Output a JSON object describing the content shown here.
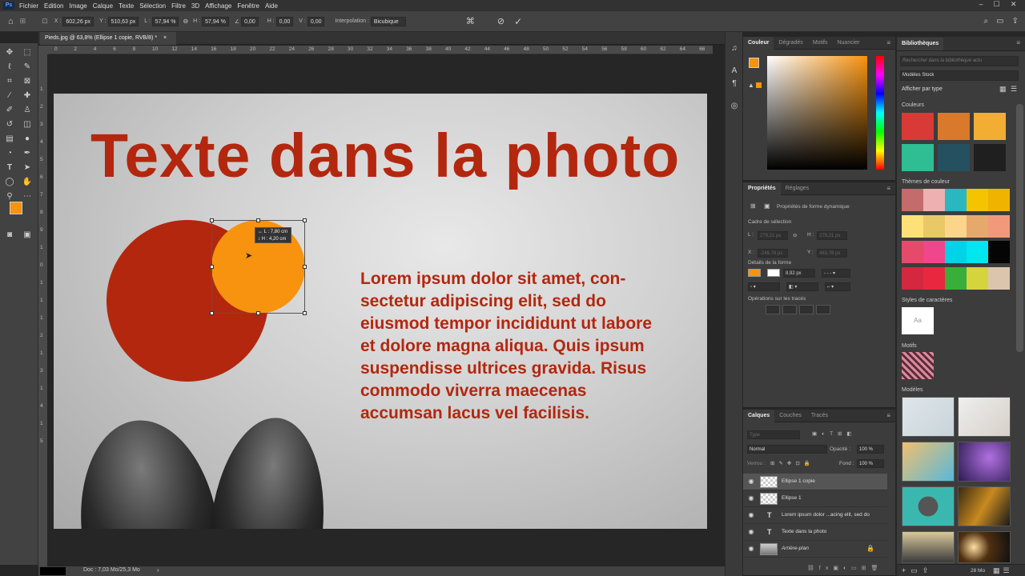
{
  "menu": {
    "logo": "Ps",
    "items": [
      "Fichier",
      "Edition",
      "Image",
      "Calque",
      "Texte",
      "Sélection",
      "Filtre",
      "3D",
      "Affichage",
      "Fenêtre",
      "Aide"
    ]
  },
  "options": {
    "x_label": "X :",
    "x": "602,26 px",
    "y_label": "Y :",
    "y": "510,63 px",
    "l_label": "L :",
    "l": "57,94 %",
    "h_label": "H :",
    "h": "57,94 %",
    "angle": "0,00",
    "h2_label": "H :",
    "h2": "0,00",
    "v_label": "V :",
    "v": "0,00",
    "interp_label": "Interpolation :",
    "interp": "Bicubique"
  },
  "document": {
    "tab": "Pieds.jpg @ 63,8% (Ellipse 1 copie, RVB/8) *",
    "close": "×"
  },
  "ruler": {
    "top": [
      "0",
      "2",
      "4",
      "6",
      "8",
      "10",
      "12",
      "14",
      "16",
      "18",
      "20",
      "22",
      "24",
      "26",
      "28",
      "30",
      "32",
      "34",
      "36",
      "38",
      "40",
      "42",
      "44",
      "46",
      "48",
      "50",
      "52",
      "54",
      "56",
      "58",
      "60",
      "62",
      "64",
      "66"
    ],
    "left": [
      "1",
      "2",
      "3",
      "4",
      "5",
      "6",
      "7",
      "8",
      "9",
      "1",
      "0",
      "1",
      "1",
      "1",
      "2",
      "1",
      "3",
      "1",
      "4",
      "1",
      "5"
    ]
  },
  "photo": {
    "headline": "Texte dans la photo",
    "body": "Lorem ipsum dolor sit amet, con-sectetur adipiscing elit, sed do eiusmod tempor incididunt ut labore et dolore magna aliqua. Quis ipsum suspendisse ultrices gravida. Risus commodo viverra maecenas accumsan lacus vel facilisis.",
    "tooltip_l": "↔ L : 7,80 cm",
    "tooltip_h": "↕ H : 4,20 cm",
    "colors": {
      "red": "#b3270f",
      "orange": "#f7930e"
    }
  },
  "status": {
    "doc": "Doc : 7,03 Mo/25,3 Mo"
  },
  "color_panel": {
    "tabs": [
      "Couleur",
      "Dégradés",
      "Motifs",
      "Nuancier"
    ]
  },
  "props_panel": {
    "tabs": [
      "Propriétés",
      "Réglages"
    ],
    "subtitle": "Propriétés de forme dynamique",
    "sec_bounds": "Cadre de sélection",
    "l": "L :",
    "l_val": "279,21 px",
    "h": "H :",
    "h_val": "279,21 px",
    "x": "X :",
    "x_val": "-246,78 px",
    "y": "Y :",
    "y_val": "463,78 px",
    "sec_shape": "Détails de la forme",
    "stroke": "8,92 px",
    "sec_ops": "Opérations sur les tracés"
  },
  "layers_panel": {
    "tabs": [
      "Calques",
      "Couches",
      "Tracés"
    ],
    "search": "Type",
    "blend": "Normal",
    "opacity_label": "Opacité :",
    "opacity": "100 %",
    "lock_label": "Verrou :",
    "fill_label": "Fond :",
    "fill": "100 %",
    "layers": [
      {
        "name": "Ellipse 1 copie",
        "kind": "shape",
        "selected": true
      },
      {
        "name": "Ellipse 1",
        "kind": "shape",
        "selected": false
      },
      {
        "name": "Lorem ipsum dolor ...acing elit, sed do",
        "kind": "text",
        "selected": false
      },
      {
        "name": "Texte dans la photo",
        "kind": "text",
        "selected": false
      },
      {
        "name": "Arrière-plan",
        "kind": "image",
        "selected": false
      }
    ]
  },
  "library": {
    "title": "Bibliothèques",
    "search": "Rechercher dans la bibliothèque actu",
    "library_name": "Modèles Stock",
    "view": "Afficher par type",
    "sec_colors": "Couleurs",
    "colors": [
      "#d93a35",
      "#d9792b",
      "#f2ae32",
      "#2fbd94",
      "#24505f",
      "#1f1f1f"
    ],
    "sec_themes": "Thèmes de couleur",
    "themes": [
      [
        "#c46b6b",
        "#eeb0b0",
        "#2ab7c0",
        "#f5c400",
        "#f0b300"
      ],
      [
        "#fde178",
        "#e8c867",
        "#fcd48a",
        "#e5a96b",
        "#f2997b"
      ],
      [
        "#e54a6b",
        "#f0468d",
        "#00d3e8",
        "#00e5ee",
        "#050505"
      ],
      [
        "#d42740",
        "#e8283f",
        "#3aae3a",
        "#d6d43c",
        "#dbc6ad"
      ]
    ],
    "sec_styles": "Styles de caractères",
    "style_sample": "Aa",
    "sec_patterns": "Motifs",
    "sec_models": "Modèles",
    "size": "28 Mo"
  }
}
